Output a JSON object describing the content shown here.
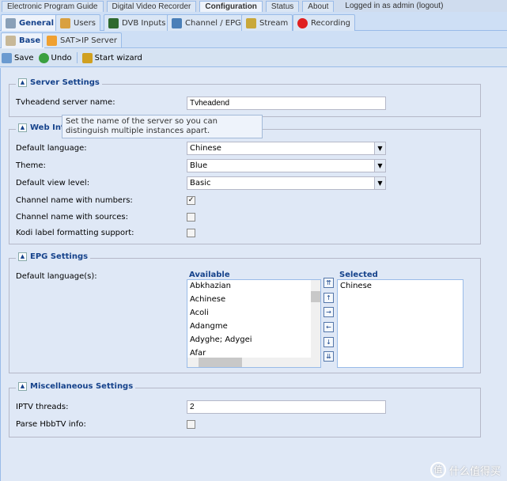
{
  "top_tabs": [
    "Electronic Program Guide",
    "Digital Video Recorder",
    "Configuration",
    "Status",
    "About"
  ],
  "login_text": "Logged in as admin",
  "logout": "(logout)",
  "config_tabs": [
    {
      "label": "General",
      "icon": "wrench-icon"
    },
    {
      "label": "Users",
      "icon": "users-icon"
    },
    {
      "label": "DVB Inputs",
      "icon": "dvb-card-icon"
    },
    {
      "label": "Channel / EPG",
      "icon": "tv-icon"
    },
    {
      "label": "Stream",
      "icon": "stream-icon"
    },
    {
      "label": "Recording",
      "icon": "rec-icon"
    }
  ],
  "sub_tabs": [
    {
      "label": "Base"
    },
    {
      "label": "SAT>IP Server"
    }
  ],
  "toolbar": {
    "save": "Save",
    "undo": "Undo",
    "wizard": "Start wizard"
  },
  "server": {
    "title": "Server Settings",
    "name_label": "Tvheadend server name:",
    "name_value": "Tvheadend"
  },
  "tooltip": "Set the name of the server so you can distinguish multiple instances apart.",
  "web": {
    "title": "Web Int",
    "lang_label": "Default language:",
    "lang_value": "Chinese",
    "theme_label": "Theme:",
    "theme_value": "Blue",
    "view_label": "Default view level:",
    "view_value": "Basic",
    "chnum_label": "Channel name with numbers:",
    "chnum_checked": true,
    "chsrc_label": "Channel name with sources:",
    "chsrc_checked": false,
    "kodi_label": "Kodi label formatting support:",
    "kodi_checked": false
  },
  "epg": {
    "title": "EPG Settings",
    "lang_label": "Default language(s):",
    "available_label": "Available",
    "selected_label": "Selected",
    "available": [
      "Abkhazian",
      "Achinese",
      "Acoli",
      "Adangme",
      "Adyghe; Adygei",
      "Afar"
    ],
    "selected": [
      "Chinese"
    ]
  },
  "misc": {
    "title": "Miscellaneous Settings",
    "iptv_label": "IPTV threads:",
    "iptv_value": "2",
    "hbbtv_label": "Parse HbbTV info:",
    "hbbtv_checked": false
  },
  "watermark": "什么值得买",
  "watermark_logo": "值"
}
